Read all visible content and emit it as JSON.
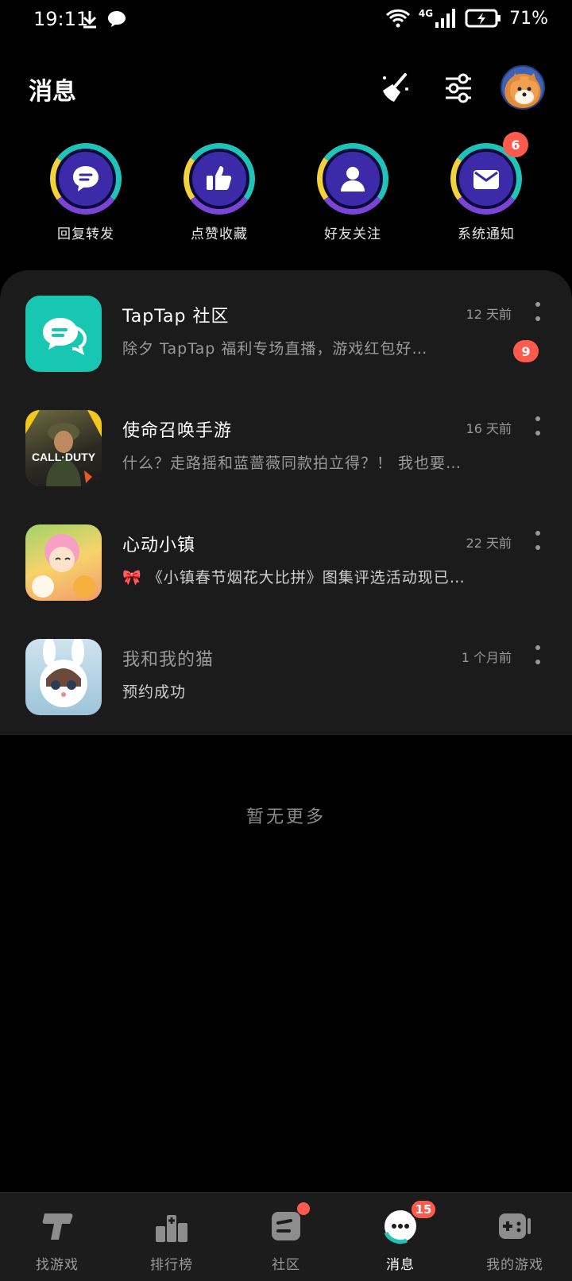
{
  "status_bar": {
    "time": "19:11",
    "network": "4G",
    "battery": "71%",
    "icons": [
      "download-icon",
      "chat-bubble-icon",
      "wifi-icon",
      "signal-icon",
      "battery-icon"
    ]
  },
  "header": {
    "title": "消息",
    "icons": [
      "clean-broom-icon",
      "settings-sliders-icon",
      "avatar"
    ]
  },
  "categories": [
    {
      "label": "回复转发",
      "icon": "reply-icon"
    },
    {
      "label": "点赞收藏",
      "icon": "thumbs-up-icon"
    },
    {
      "label": "好友关注",
      "icon": "user-icon"
    },
    {
      "label": "系统通知",
      "icon": "envelope-icon",
      "badge": "6"
    }
  ],
  "messages": [
    {
      "title": "TapTap 社区",
      "subtitle": "除夕 TapTap 福利专场直播，游戏红包好…",
      "time": "12 天前",
      "badge": "9",
      "icon": "taptap-community-icon"
    },
    {
      "title": "使命召唤手游",
      "subtitle": "什么？走路摇和蓝蔷薇同款拍立得？！ 我也要…",
      "time": "16 天前",
      "icon": "call-of-duty-icon"
    },
    {
      "title": "心动小镇",
      "subtitle": "🎀 《小镇春节烟花大比拼》图集评选活动现已…",
      "time": "22 天前",
      "icon": "heartbeat-town-icon"
    },
    {
      "title": "我和我的猫",
      "subtitle": "预约成功",
      "time": "1 个月前",
      "icon": "my-cat-icon"
    }
  ],
  "empty_text": "暂无更多",
  "tabs": [
    {
      "label": "找游戏",
      "icon": "find-games-icon"
    },
    {
      "label": "排行榜",
      "icon": "ranking-icon"
    },
    {
      "label": "社区",
      "icon": "community-icon",
      "dot": true
    },
    {
      "label": "消息",
      "icon": "messages-icon",
      "badge": "15",
      "active": true
    },
    {
      "label": "我的游戏",
      "icon": "gamepad-icon"
    }
  ],
  "colors": {
    "background": "#000000",
    "panel": "#1b1b1b",
    "badge": "#ff5a4e",
    "accent_teal": "#20c4b6",
    "accent_purple": "#3c2aa8"
  }
}
